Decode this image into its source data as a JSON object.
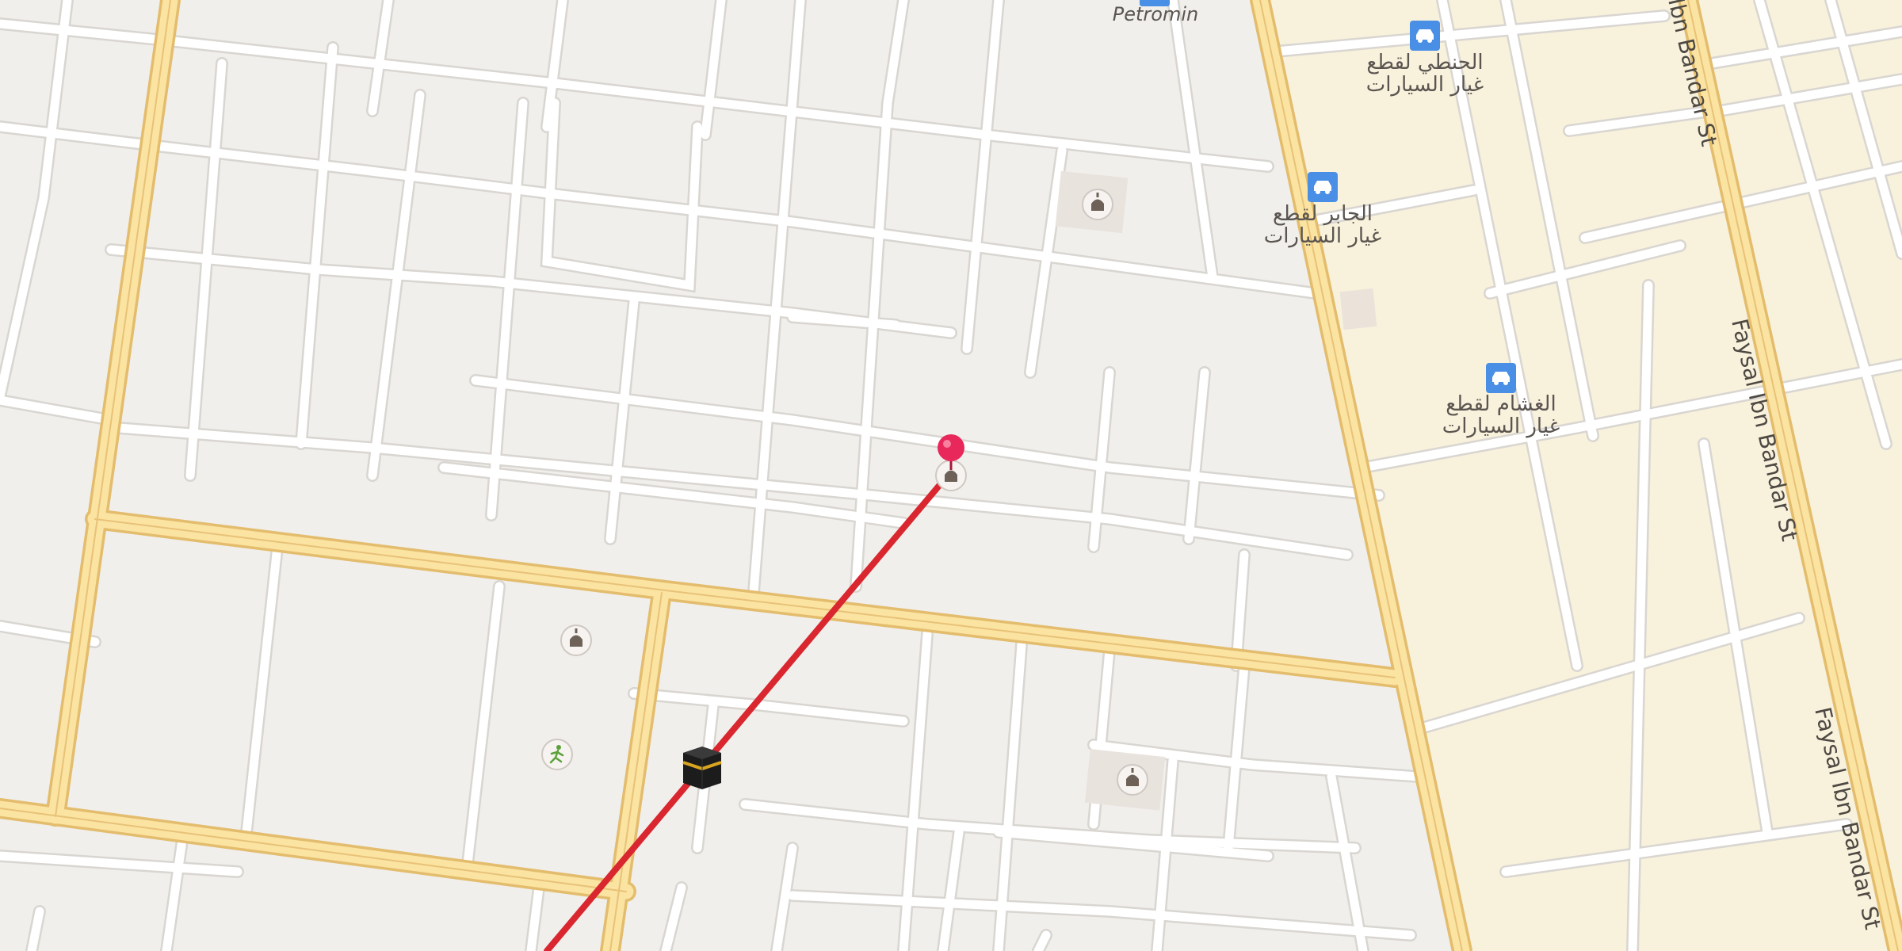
{
  "map": {
    "colors": {
      "land": "#f1efec",
      "district": "#f8f1dc",
      "minor_road": "#ffffff",
      "minor_road_edge": "#d9d6d1",
      "major_road": "#fbe3a2",
      "major_road_edge": "#e3bd6d",
      "route": "#d9262f",
      "pin": "#e8285a",
      "poi_car": "#4a8fe6",
      "poi_building": "#8a7a6e"
    },
    "street_labels": {
      "faysal_top": "Ibn Bandar St",
      "faysal_mid": "Faysal Ibn Bandar St",
      "faysal_bottom": "Faysal Ibn Bandar St"
    },
    "poi_labels": {
      "petromin": "Petromin",
      "shop1_line1": "الحنطي لقطع",
      "shop1_line2": "غيار السيارات",
      "shop2_line1": "الجابر لقطع",
      "shop2_line2": "غيار السيارات",
      "shop3_line1": "الغشام لقطع",
      "shop3_line2": "غيار السيارات"
    },
    "icons": {
      "car_poi": "car-icon",
      "mosque_poi": "mosque-icon",
      "kaaba": "kaaba-icon",
      "park": "person-walking-icon",
      "pin": "location-pin-icon"
    }
  }
}
